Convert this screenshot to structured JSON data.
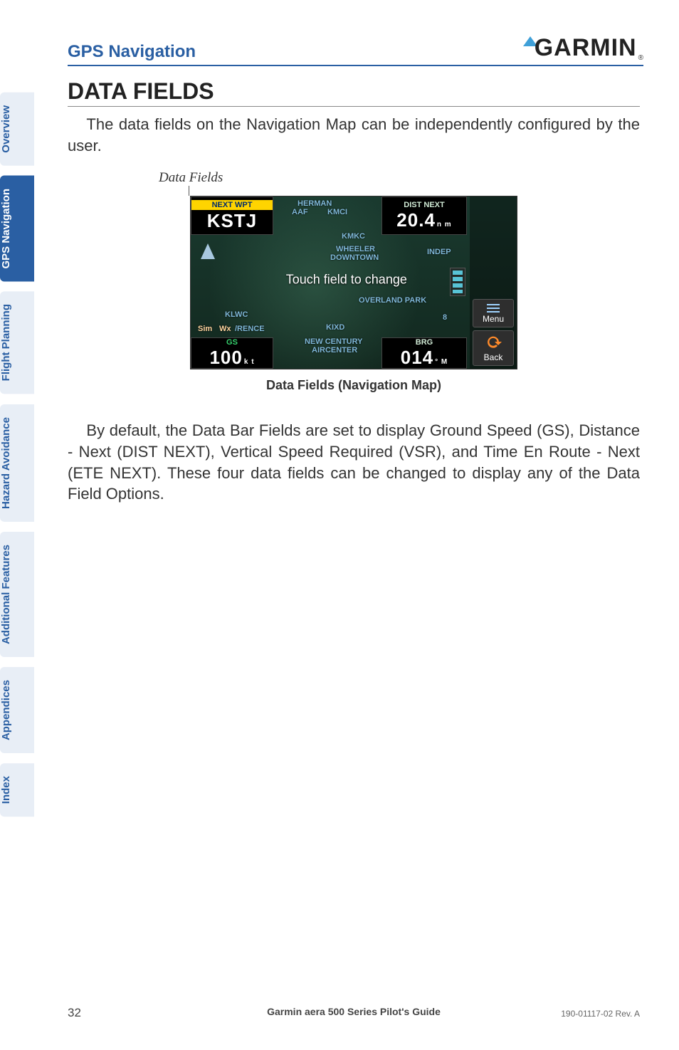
{
  "header": {
    "section": "GPS Navigation",
    "logo_text": "GARMIN",
    "logo_reg": "®"
  },
  "tabs": [
    {
      "label": "Overview",
      "active": false
    },
    {
      "label": "GPS Navigation",
      "active": true
    },
    {
      "label": "Flight Planning",
      "active": false
    },
    {
      "label": "Hazard Avoidance",
      "active": false
    },
    {
      "label": "Additional Features",
      "active": false
    },
    {
      "label": "Appendices",
      "active": false
    },
    {
      "label": "Index",
      "active": false
    }
  ],
  "title": "DATA FIELDS",
  "para1": "The data fields on the Navigation Map can be independently configured by the user.",
  "callout": "Data Fields",
  "device": {
    "fields": {
      "tl": {
        "label": "NEXT WPT",
        "value": "KSTJ",
        "unit": ""
      },
      "tr": {
        "label": "DIST NEXT",
        "value": "20.4",
        "unit": "n m"
      },
      "bl": {
        "label": "GS",
        "value": "100",
        "unit": "k t"
      },
      "br": {
        "label": "BRG",
        "value": "014",
        "unit": "° M"
      }
    },
    "touch_msg": "Touch field to change",
    "map_labels": {
      "kmci": "KMCI",
      "kmkc": "KMKC",
      "wheeler": "WHEELER",
      "downtown": "DOWNTOWN",
      "indep": "INDEP",
      "overland": "OVERLAND PARK",
      "klwc": "KLWC",
      "sim": "Sim",
      "wx": "Wx",
      "rence": "/RENCE",
      "kixd": "KIXD",
      "newcentury": "NEW CENTURY",
      "aircenter": "AIRCENTER",
      "herman": "HERMAN",
      "aaf": "AAF",
      "eight": "8"
    },
    "side": {
      "menu": "Menu",
      "back": "Back"
    }
  },
  "caption": "Data Fields (Navigation Map)",
  "para2": "By default, the Data Bar Fields are set to display Ground Speed (GS), Distance - Next (DIST NEXT), Vertical Speed Required (VSR), and Time En Route - Next (ETE NEXT). These four data fields can be changed to display any of the Data Field Options.",
  "footer": {
    "page": "32",
    "mid": "Garmin aera 500 Series Pilot's Guide",
    "rev": "190-01117-02  Rev. A"
  }
}
